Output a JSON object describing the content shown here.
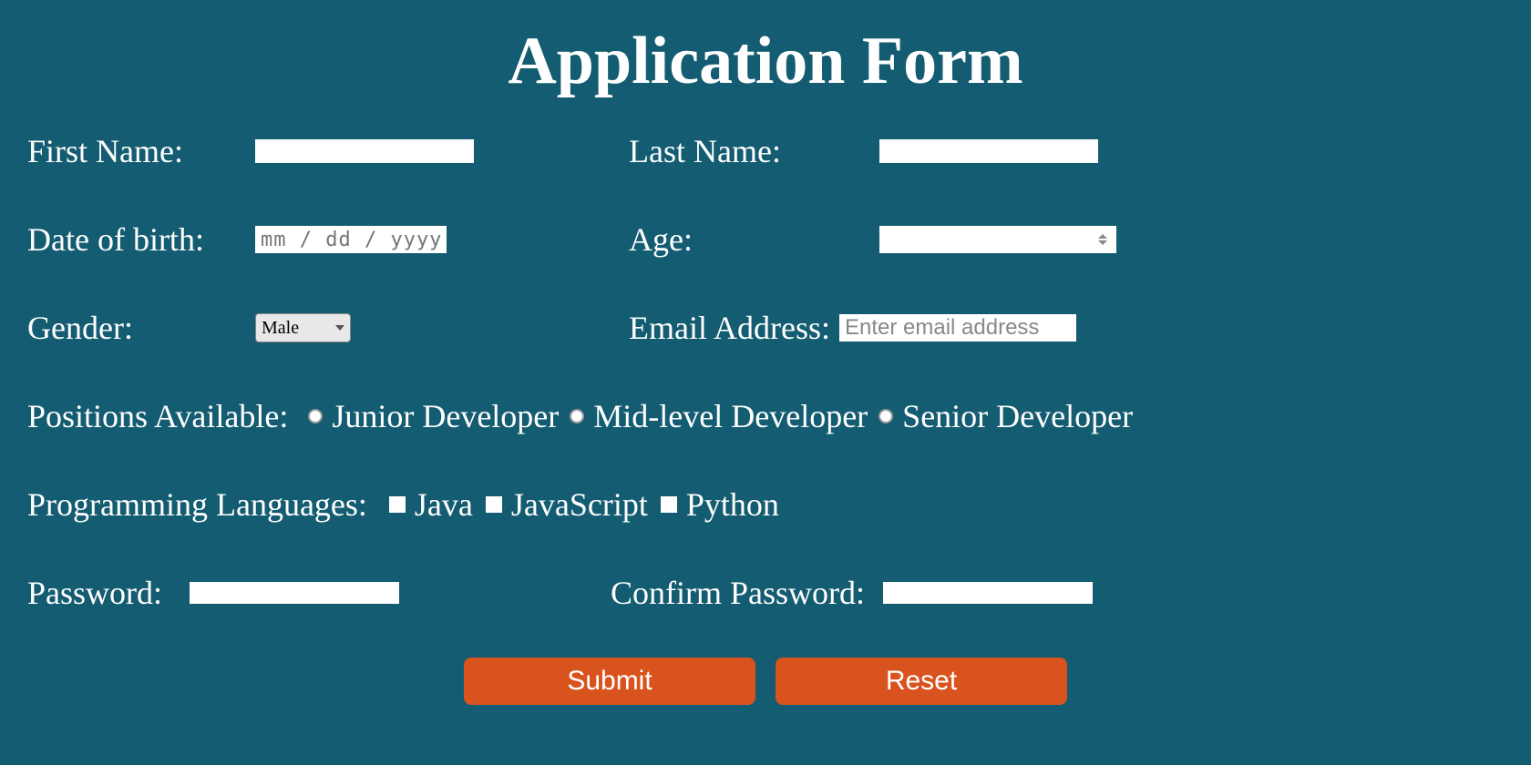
{
  "title": "Application Form",
  "fields": {
    "first_name": {
      "label": "First Name:",
      "value": ""
    },
    "last_name": {
      "label": "Last Name:",
      "value": ""
    },
    "dob": {
      "label": "Date of birth:",
      "placeholder": "mm / dd / yyyy",
      "value": ""
    },
    "age": {
      "label": "Age:",
      "value": ""
    },
    "gender": {
      "label": "Gender:",
      "selected": "Male"
    },
    "email": {
      "label": "Email Address:",
      "placeholder": "Enter email address",
      "value": ""
    },
    "positions": {
      "label": "Positions Available:",
      "options": [
        "Junior Developer",
        "Mid-level Developer",
        "Senior Developer"
      ]
    },
    "languages": {
      "label": "Programming Languages:",
      "options": [
        "Java",
        "JavaScript",
        "Python"
      ]
    },
    "password": {
      "label": "Password:",
      "value": ""
    },
    "confirm_password": {
      "label": "Confirm Password:",
      "value": ""
    }
  },
  "buttons": {
    "submit": "Submit",
    "reset": "Reset"
  }
}
